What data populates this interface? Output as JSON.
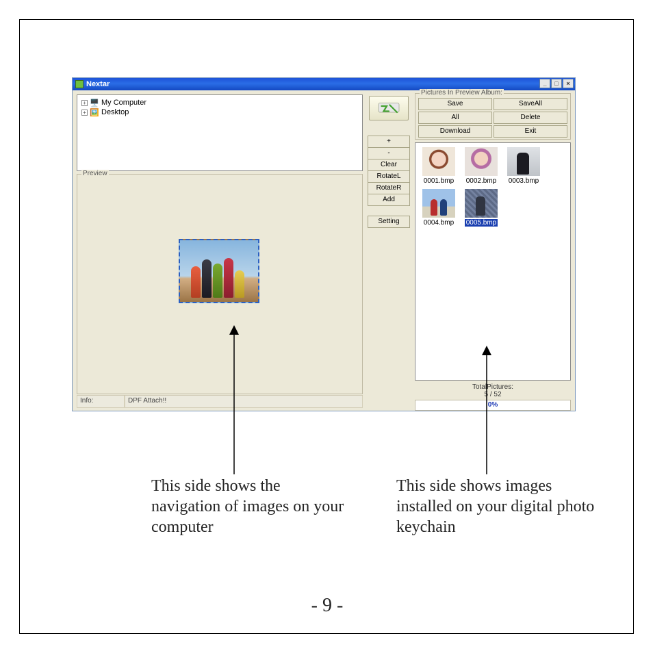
{
  "window": {
    "title": "Nextar"
  },
  "tree": {
    "items": [
      {
        "label": "My Computer"
      },
      {
        "label": "Desktop"
      }
    ]
  },
  "preview": {
    "label": "Preview"
  },
  "info": {
    "label": "Info:",
    "text": "DPF Attach!!"
  },
  "center_buttons": {
    "plus": "+",
    "minus": "-",
    "clear": "Clear",
    "rotate_l": "RotateL",
    "rotate_r": "RotateR",
    "add": "Add",
    "setting": "Setting"
  },
  "album": {
    "label": "Pictures In Preview Album:",
    "save": "Save",
    "save_all": "SaveAll",
    "all": "All",
    "delete": "Delete",
    "download": "Download",
    "exit": "Exit"
  },
  "thumbs": [
    {
      "label": "0001.bmp"
    },
    {
      "label": "0002.bmp"
    },
    {
      "label": "0003.bmp"
    },
    {
      "label": "0004.bmp"
    },
    {
      "label": "0005.bmp",
      "selected": true
    }
  ],
  "total": {
    "label": "TotalPictures:",
    "value": "5 / 52"
  },
  "progress": {
    "text": "0%"
  },
  "annotations": {
    "left": "This side shows the navigation of images on your computer",
    "right": "This side shows images installed on your digital photo keychain"
  },
  "page_number": "- 9 -"
}
